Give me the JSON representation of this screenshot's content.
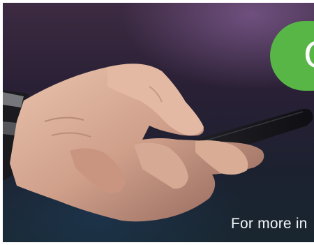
{
  "banner": {
    "pill_text": "C",
    "caption_text": "For more in",
    "colors": {
      "pill": "#58b647",
      "caption": "#f3f5f8",
      "background": "#25202f"
    }
  },
  "image": {
    "subject": "hand-holding-smartphone-photo"
  }
}
